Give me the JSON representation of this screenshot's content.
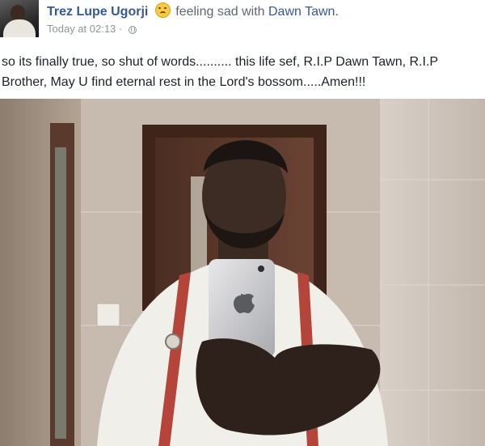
{
  "post": {
    "author": "Trez Lupe Ugorji",
    "feeling_prefix": "feeling sad with",
    "feeling_target": "Dawn Tawn.",
    "feeling_emoji": "sad-face-icon",
    "timestamp": "Today at 02:13",
    "separator": "·",
    "privacy_icon": "globe-icon",
    "text": "so its finally true, so shut of words.......... this life sef, R.I.P Dawn Tawn, R.I.P Brother, May U find eternal rest in the Lord's bossom.....Amen!!!"
  },
  "colors": {
    "link": "#365899",
    "meta": "#90949c",
    "text": "#1d2129"
  }
}
